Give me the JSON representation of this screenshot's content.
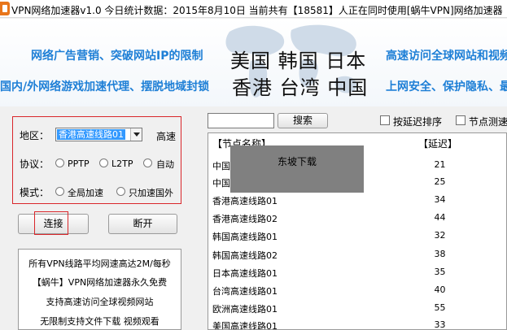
{
  "window": {
    "title": "VPN网络加速器v1.0 今日统计数据：2015年8月10日 当前共有【18581】人正在同时使用[蜗牛VPN]网络加速器"
  },
  "banner": {
    "left_line1": "网络广告营销、突破网站IP的限制",
    "left_line2": "国内/外网络游戏加速代理、摆脱地域封锁",
    "center_line1": "美国 韩国 日本",
    "center_line2": "香港 台湾 中国",
    "right_line1": "高速访问全球网站和视频",
    "right_line2": "上网安全、保护隐私、最"
  },
  "settings": {
    "region_label": "地区：",
    "region_value": "香港高速线路01",
    "region_suffix": "高速",
    "protocol_label": "协议：",
    "protocol_options": [
      "PPTP",
      "L2TP",
      "自动"
    ],
    "mode_label": "模式：",
    "mode_options": [
      "全局加速",
      "只加速国外"
    ]
  },
  "actions": {
    "connect": "连接",
    "disconnect": "断开",
    "search": "搜索"
  },
  "info_lines": [
    "所有VPN线路平均网速高达2M/每秒",
    "【蜗牛】VPN网络加速器永久免费",
    "支持高速访问全球视频网站",
    "无限制支持文件下载 视频观看"
  ],
  "filters": {
    "sort_by_latency": "按延迟排序",
    "node_test": "节点测速"
  },
  "list": {
    "col_name": "【节点名称】",
    "col_latency": "【延迟】",
    "rows": [
      {
        "name": "中国",
        "latency": "21"
      },
      {
        "name": "中国",
        "latency": "25"
      },
      {
        "name": "香港高速线路01",
        "latency": "34"
      },
      {
        "name": "香港高速线路02",
        "latency": "44"
      },
      {
        "name": "韩国高速线路01",
        "latency": "32"
      },
      {
        "name": "韩国高速线路02",
        "latency": "38"
      },
      {
        "name": "日本高速线路01",
        "latency": "35"
      },
      {
        "name": "台湾高速线路01",
        "latency": "40"
      },
      {
        "name": "欧洲高速线路01",
        "latency": "55"
      },
      {
        "name": "美国高速线路01",
        "latency": "33"
      }
    ]
  },
  "overlay": {
    "text": "东坡下载"
  },
  "colors": {
    "accent_blue": "#1e7fd6",
    "highlight_red": "#d9262a",
    "selection_blue": "#3399ff",
    "overlay_gray": "#808080"
  }
}
